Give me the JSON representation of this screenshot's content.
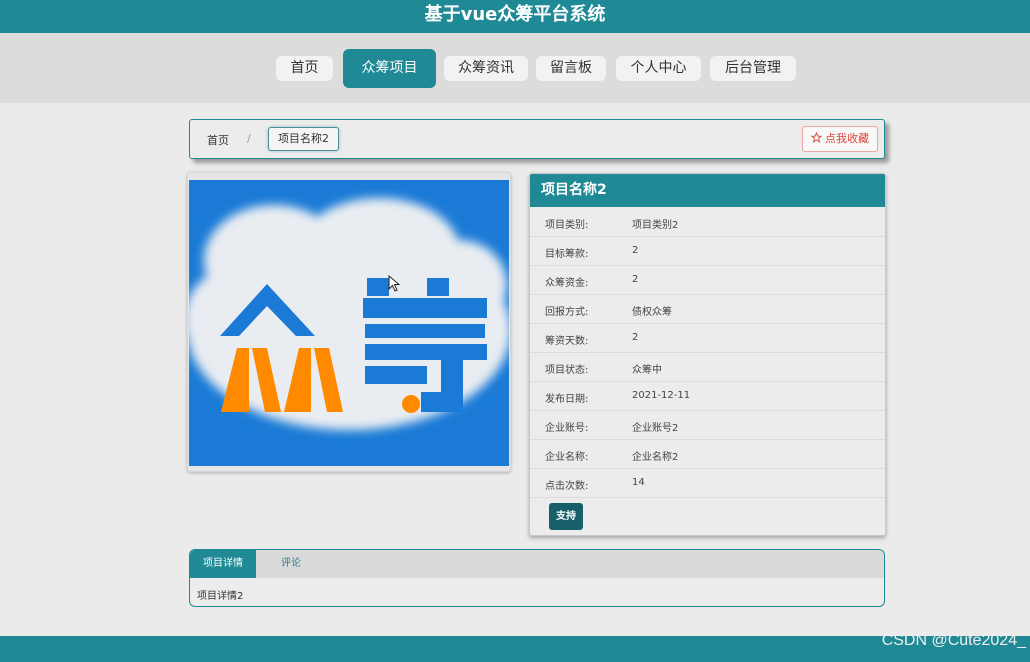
{
  "header": {
    "title": "基于vue众筹平台系统"
  },
  "nav": {
    "items": [
      "首页",
      "众筹项目",
      "众筹资讯",
      "留言板",
      "个人中心",
      "后台管理"
    ],
    "active_index": 1
  },
  "breadcrumb": {
    "home": "首页",
    "separator": "/",
    "current": "项目名称2",
    "favorite_label": "点我收藏",
    "favorite_icon": "star-outline-icon"
  },
  "project": {
    "image_text": "众筹",
    "title": "项目名称2",
    "fields": [
      {
        "label": "项目类别:",
        "value": "项目类别2"
      },
      {
        "label": "目标筹款:",
        "value": "2"
      },
      {
        "label": "众筹资金:",
        "value": "2"
      },
      {
        "label": "回报方式:",
        "value": "债权众筹"
      },
      {
        "label": "筹资天数:",
        "value": "2"
      },
      {
        "label": "项目状态:",
        "value": "众筹中"
      },
      {
        "label": "发布日期:",
        "value": "2021-12-11"
      },
      {
        "label": "企业账号:",
        "value": "企业账号2"
      },
      {
        "label": "企业名称:",
        "value": "企业名称2"
      },
      {
        "label": "点击次数:",
        "value": "14"
      }
    ],
    "support_label": "支持"
  },
  "tabs": {
    "items": [
      "项目详情",
      "评论"
    ],
    "active_index": 0,
    "content": "项目详情2"
  },
  "watermark": "CSDN @Cute2024_",
  "colors": {
    "primary": "#1f8a96",
    "support_button": "#17606b",
    "favorite": "#d9463b",
    "image_blue": "#1a7ad6",
    "image_orange": "#ff8a00"
  }
}
